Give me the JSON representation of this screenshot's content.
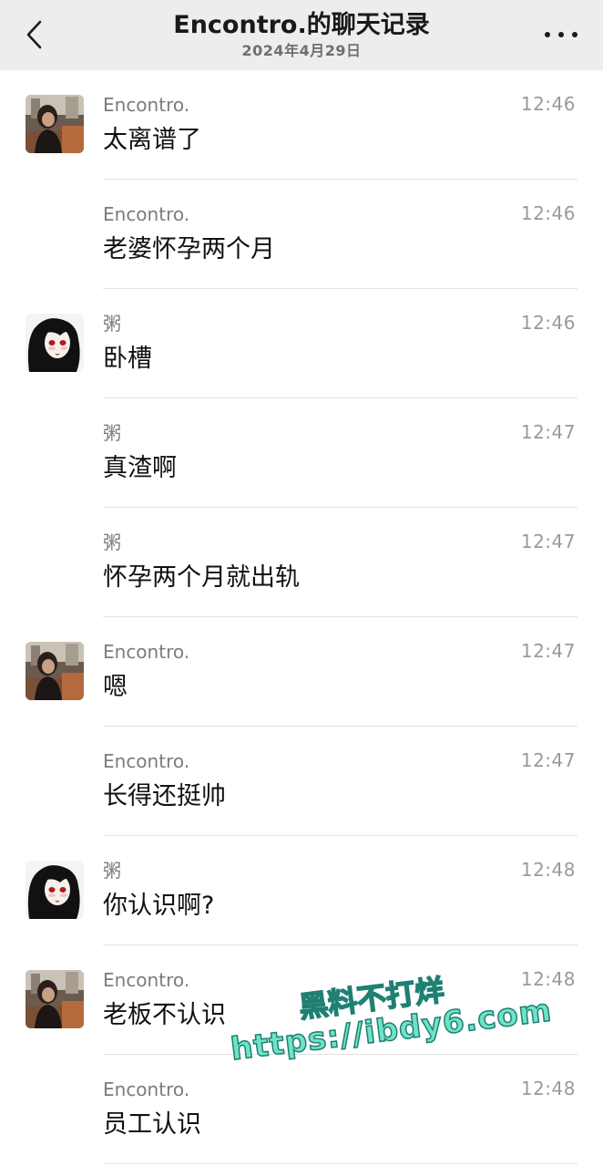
{
  "header": {
    "title": "Encontro.的聊天记录",
    "date": "2024年4月29日"
  },
  "icons": {
    "back": "chevron-left-icon",
    "more": "more-horizontal-icon"
  },
  "messages": [
    {
      "sender": "Encontro.",
      "time": "12:46",
      "text": "太离谱了",
      "avatar": "encontro"
    },
    {
      "sender": "Encontro.",
      "time": "12:46",
      "text": "老婆怀孕两个月",
      "avatar": ""
    },
    {
      "sender": "粥",
      "time": "12:46",
      "text": "卧槽",
      "avatar": "zhou"
    },
    {
      "sender": "粥",
      "time": "12:47",
      "text": "真渣啊",
      "avatar": ""
    },
    {
      "sender": "粥",
      "time": "12:47",
      "text": "怀孕两个月就出轨",
      "avatar": ""
    },
    {
      "sender": "Encontro.",
      "time": "12:47",
      "text": "嗯",
      "avatar": "encontro"
    },
    {
      "sender": "Encontro.",
      "time": "12:47",
      "text": "长得还挺帅",
      "avatar": ""
    },
    {
      "sender": "粥",
      "time": "12:48",
      "text": "你认识啊?",
      "avatar": "zhou"
    },
    {
      "sender": "Encontro.",
      "time": "12:48",
      "text": "老板不认识",
      "avatar": "encontro"
    },
    {
      "sender": "Encontro.",
      "time": "12:48",
      "text": "员工认识",
      "avatar": ""
    }
  ],
  "watermark": {
    "line1": "黑料不打烊",
    "line2": "https://ibdy6.com"
  },
  "colors": {
    "header_bg": "#ededed",
    "sender": "#7c7c7c",
    "time": "#9a9a9a",
    "watermark": "#6fe3c8"
  }
}
